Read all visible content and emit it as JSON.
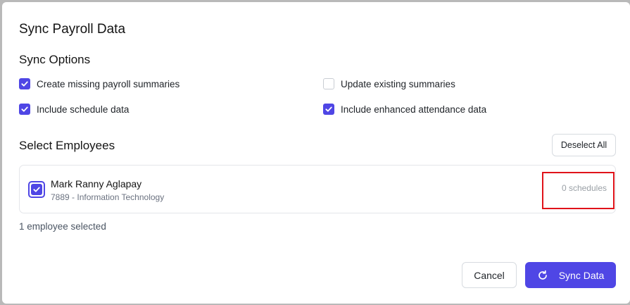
{
  "dialog": {
    "title": "Sync Payroll Data"
  },
  "sync_options": {
    "heading": "Sync Options",
    "options": [
      {
        "label": "Create missing payroll summaries",
        "checked": true
      },
      {
        "label": "Update existing summaries",
        "checked": false
      },
      {
        "label": "Include schedule data",
        "checked": true
      },
      {
        "label": "Include enhanced attendance data",
        "checked": true
      }
    ]
  },
  "employees": {
    "heading": "Select Employees",
    "deselect_all_label": "Deselect All",
    "list": [
      {
        "name": "Mark Ranny Aglapay",
        "subtitle": "7889 - Information Technology",
        "schedules": "0 schedules",
        "checked": true
      }
    ],
    "selected_count": "1 employee selected"
  },
  "footer": {
    "cancel_label": "Cancel",
    "sync_label": "Sync Data"
  },
  "colors": {
    "accent": "#4f46e5",
    "highlight": "#e0131a"
  },
  "icons": {
    "check": "check-icon",
    "sync": "refresh-icon"
  }
}
